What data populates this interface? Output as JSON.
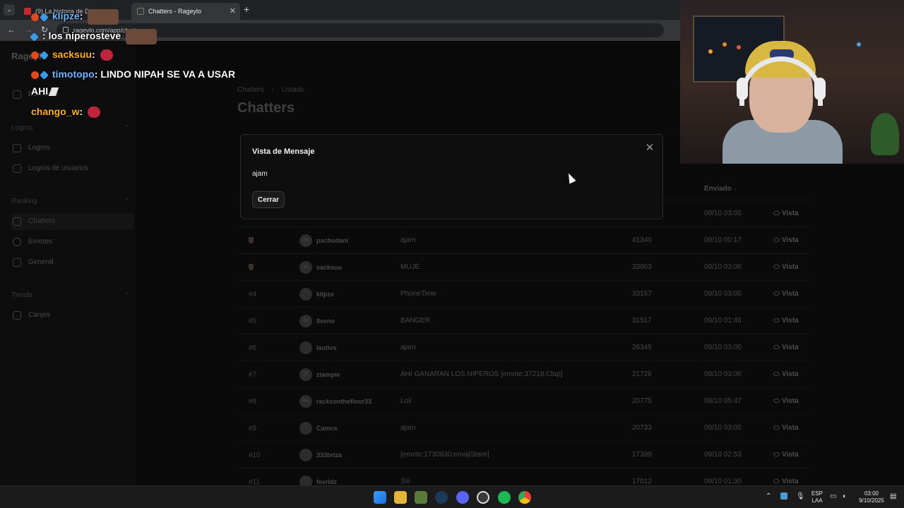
{
  "browser": {
    "tabs": [
      {
        "label": "(9) La historia de Dev..."
      },
      {
        "label": "Chatters - Rageylo"
      }
    ],
    "url": "rageylo.com/app/chatters"
  },
  "sidebar": {
    "brand": "Rageylo",
    "top_item": "Escritorio",
    "sections": [
      {
        "label": "Logros",
        "items": [
          "Logros",
          "Logros de usuarios"
        ]
      },
      {
        "label": "Ranking",
        "items": [
          "Chatters",
          "Emotes",
          "General"
        ]
      },
      {
        "label": "Tienda",
        "items": [
          "Canjes"
        ]
      }
    ]
  },
  "page": {
    "breadcrumb": [
      "Chatters",
      "Listado"
    ],
    "title": "Chatters",
    "column_sent": "Enviado"
  },
  "table": {
    "view_label": "Vista",
    "rows": [
      {
        "rank": "",
        "user": "",
        "initials": "",
        "message": "",
        "count": "",
        "date": "09/10 03:00"
      },
      {
        "rank": "",
        "user": "pachudani",
        "initials": "PA",
        "message": "ajam",
        "count": "41340",
        "date": "09/10 00:17"
      },
      {
        "rank": "",
        "user": "sacksuu",
        "initials": "SA",
        "message": "MUJE",
        "count": "33863",
        "date": "09/10 03:00"
      },
      {
        "rank": "#4",
        "user": "klipze",
        "initials": "",
        "message": "PhoneTime",
        "count": "33157",
        "date": "09/10 03:00"
      },
      {
        "rank": "#5",
        "user": "8veno",
        "initials": "8V",
        "message": "BANGER",
        "count": "31517",
        "date": "09/10 01:46"
      },
      {
        "rank": "#6",
        "user": "lautivs",
        "initials": "",
        "message": "ajam",
        "count": "26345",
        "date": "09/10 03:00"
      },
      {
        "rank": "#7",
        "user": "ztampie",
        "initials": "ZT",
        "message": "AHI GANARAN LOS NIPEROS [emote:37218:Clap]",
        "count": "21726",
        "date": "09/10 03:00"
      },
      {
        "rank": "#8",
        "user": "racksonthefloor33",
        "initials": "RA",
        "message": "Loli",
        "count": "20775",
        "date": "08/10 05:47"
      },
      {
        "rank": "#9",
        "user": "Camcs",
        "initials": "",
        "message": "ajam",
        "count": "20733",
        "date": "09/10 03:00"
      },
      {
        "rank": "#10",
        "user": "333briza",
        "initials": "",
        "message": "[emote:1730830:emojiStare]",
        "count": "17399",
        "date": "09/10 02:53"
      },
      {
        "rank": "#11",
        "user": "feerldz",
        "initials": "",
        "message": "Siii",
        "count": "17012",
        "date": "09/10 01:30"
      }
    ]
  },
  "modal": {
    "title": "Vista de Mensaje",
    "message": "ajam",
    "close_button": "Cerrar",
    "close_icon": "close-icon"
  },
  "chat_overlay": {
    "lines": [
      {
        "user": "klipze",
        "text": ""
      },
      {
        "user": "",
        "text": ": los niperosteve"
      },
      {
        "user": "sacksuu",
        "text": ""
      },
      {
        "user": "timotopo",
        "text": "LINDO NIPAH SE VA A USAR"
      },
      {
        "user": "",
        "text": "AHI"
      },
      {
        "user": "chango_w",
        "text": ""
      }
    ]
  },
  "taskbar": {
    "language": "ESP",
    "layout": "LAA",
    "time": "03:00",
    "date": "9/10/2025"
  },
  "colors": {
    "modal_bg": "#0e0e0f",
    "chat_name": "#ffb020",
    "brand": "#4d4d4d"
  }
}
